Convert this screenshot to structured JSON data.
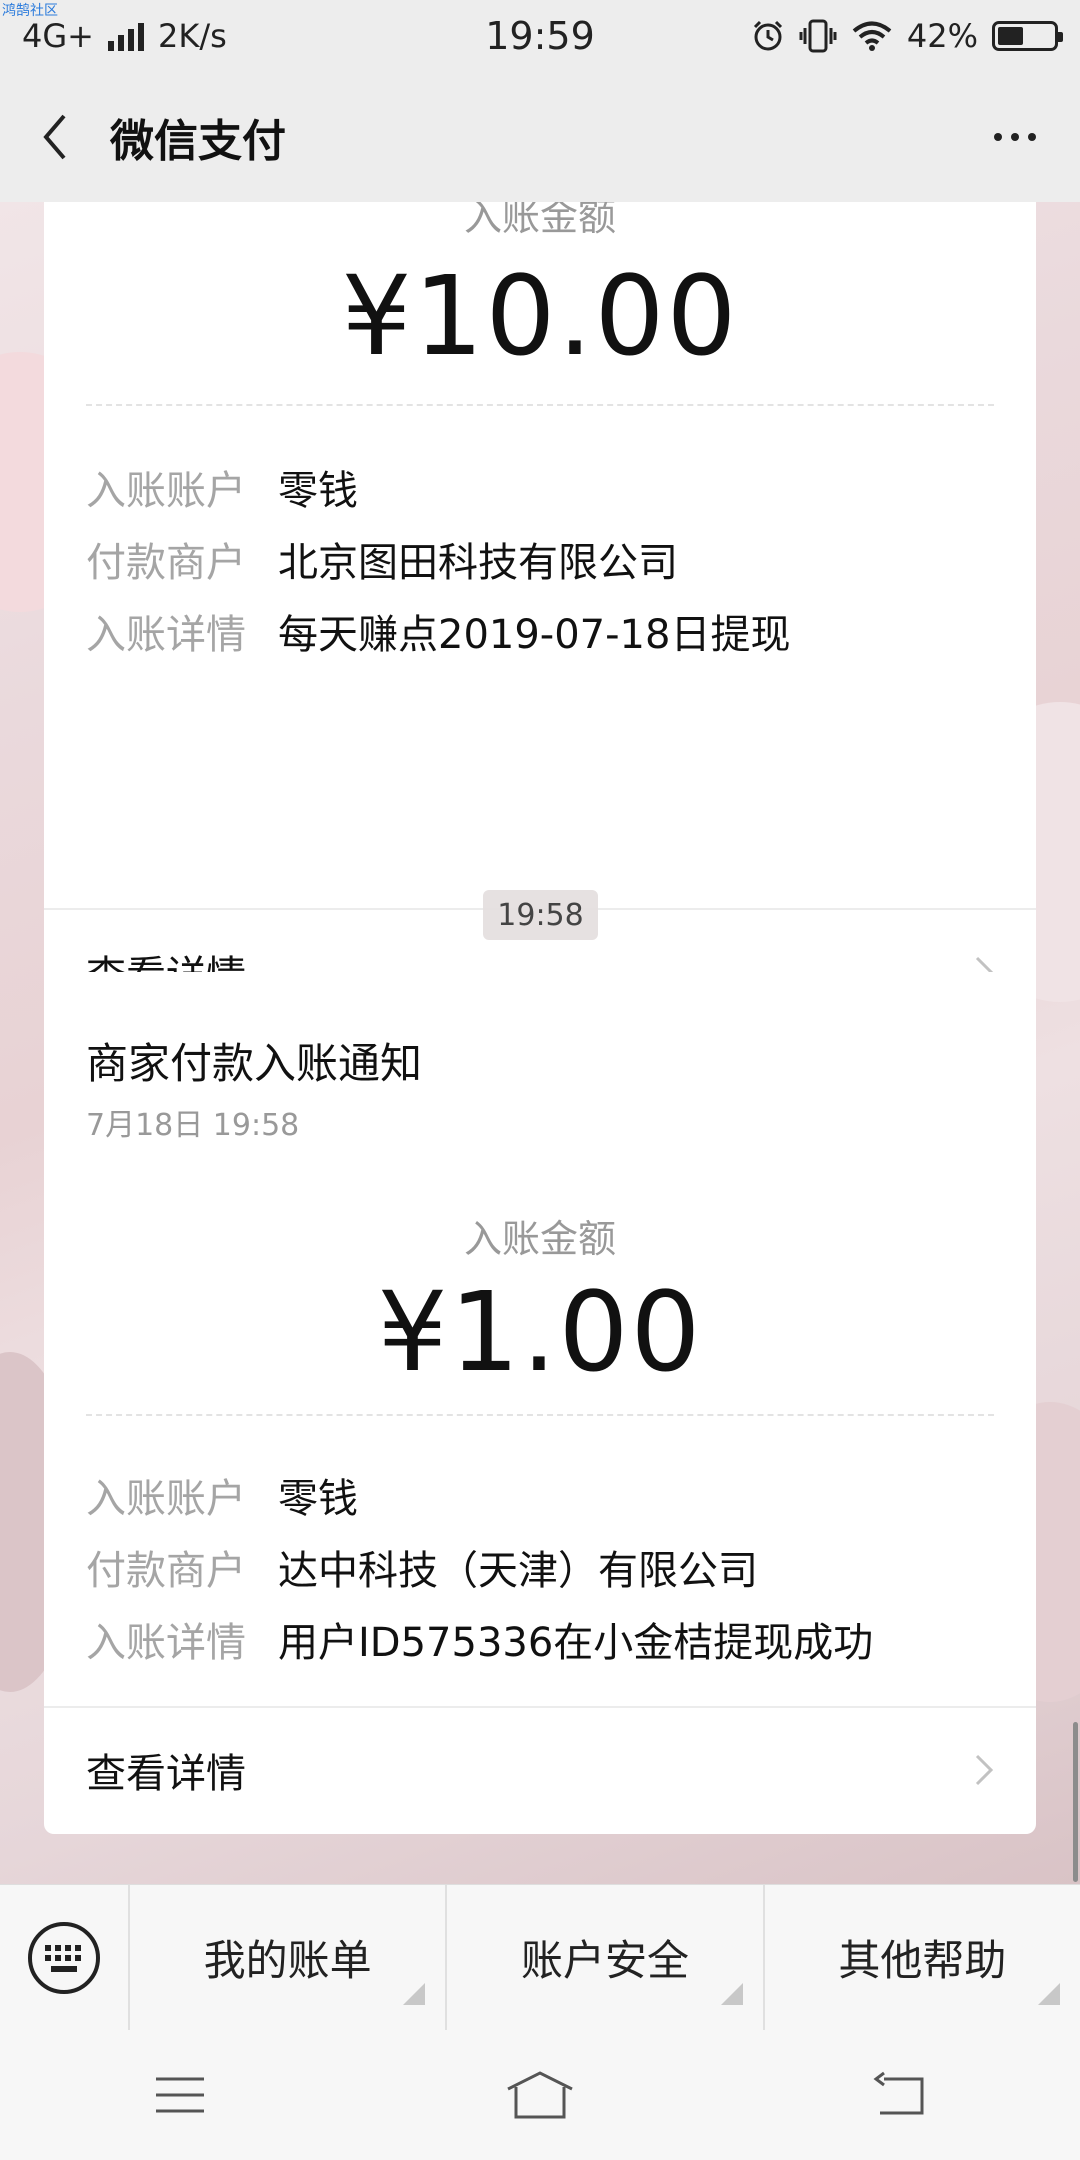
{
  "status_bar": {
    "watermark": "鸿鹄社区",
    "network": "4G+",
    "speed": "2K/s",
    "time": "19:59",
    "battery": "42%",
    "battery_level": 0.42
  },
  "header": {
    "title": "微信支付",
    "back_icon": "chevron-left-icon",
    "more_icon": "more-dots-icon"
  },
  "messages": [
    {
      "amount_label": "入账金额",
      "amount": "¥10.00",
      "rows": [
        {
          "key": "入账账户",
          "value": "零钱"
        },
        {
          "key": "付款商户",
          "value": "北京图田科技有限公司"
        },
        {
          "key": "入账详情",
          "value": "每天赚点2019-07-18日提现"
        }
      ],
      "detail_link": "查看详情"
    },
    {
      "time_chip": "19:58",
      "title": "商家付款入账通知",
      "time": "7月18日  19:58",
      "amount_label": "入账金额",
      "amount": "¥1.00",
      "rows": [
        {
          "key": "入账账户",
          "value": "零钱"
        },
        {
          "key": "付款商户",
          "value": "达中科技（天津）有限公司"
        },
        {
          "key": "入账详情",
          "value": "用户ID575336在小金桔提现成功"
        }
      ],
      "detail_link": "查看详情"
    }
  ],
  "bottom_menu": {
    "keyboard_icon": "keyboard-icon",
    "items": [
      "我的账单",
      "账户安全",
      "其他帮助"
    ]
  },
  "nav_bar": {
    "icons": [
      "menu-icon",
      "home-icon",
      "back-icon"
    ]
  },
  "colors": {
    "header_bg": "#ededed",
    "card_bg": "#ffffff",
    "muted_text": "#999999",
    "label_text": "#a5a5a5"
  }
}
